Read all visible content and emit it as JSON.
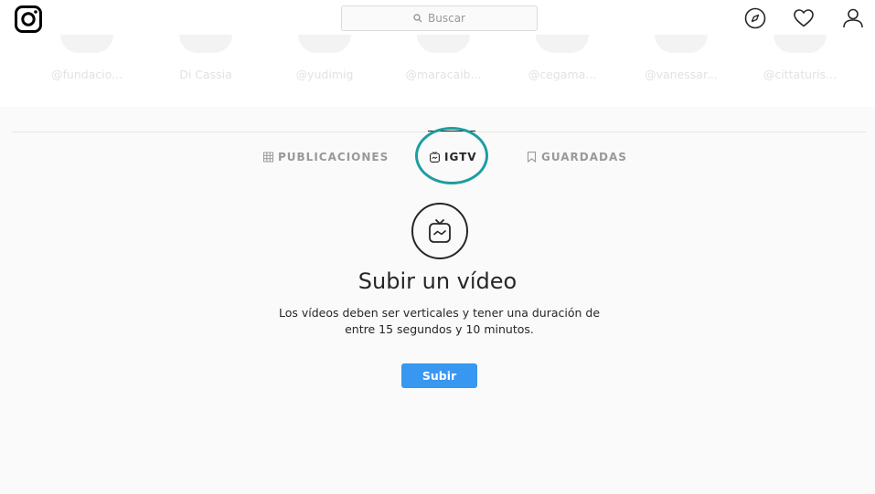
{
  "header": {
    "logo_icon": "instagram-logo-icon",
    "search_placeholder": "Buscar",
    "nav_icons": [
      "compass-icon",
      "heart-icon",
      "user-icon"
    ]
  },
  "stories": [
    "@fundacio...",
    "Di Cassia",
    "@yudimig",
    "@maracaib...",
    "@cegama...",
    "@vanessar...",
    "@cittaturis..."
  ],
  "tabs": [
    {
      "label": "PUBLICACIONES",
      "icon": "grid-icon"
    },
    {
      "label": "IGTV",
      "icon": "igtv-icon",
      "active": true
    },
    {
      "label": "GUARDADAS",
      "icon": "bookmark-icon"
    }
  ],
  "empty_state": {
    "icon": "igtv-tv-icon",
    "title": "Subir un vídeo",
    "description_line1": "Los vídeos deben ser verticales y tener una duración de",
    "description_line2": "entre 15 segundos y 10 minutos.",
    "button_label": "Subir"
  },
  "colors": {
    "accent": "#3897f0",
    "highlight_ring": "#1d9ea1",
    "text": "#262626",
    "muted": "#999999",
    "background": "#fafafa"
  }
}
